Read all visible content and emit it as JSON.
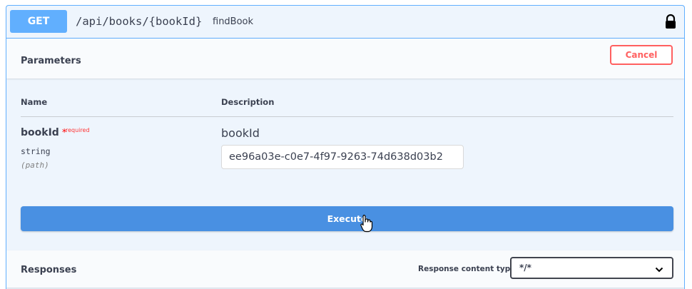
{
  "operation": {
    "method": "GET",
    "path": "/api/books/{bookId}",
    "operation_id": "findBook",
    "lock_icon": "lock-icon"
  },
  "parameters_section": {
    "title": "Parameters",
    "cancel_label": "Cancel",
    "columns": {
      "name": "Name",
      "description": "Description"
    },
    "param": {
      "name": "bookId",
      "required_star": "*",
      "required_label": "required",
      "type": "string",
      "location": "(path)",
      "description": "bookId",
      "value": "ee96a03e-c0e7-4f97-9263-74d638d03b2"
    }
  },
  "execute_label": "Execute",
  "responses_section": {
    "title": "Responses",
    "content_type_label": "Response content type",
    "content_type_value": "*/*",
    "chevron_icon": "chevron-down-icon"
  },
  "colors": {
    "get_accent": "#61affe",
    "execute_blue": "#4990e2",
    "cancel_red": "#ff6060",
    "block_bg": "#eef5fd"
  }
}
